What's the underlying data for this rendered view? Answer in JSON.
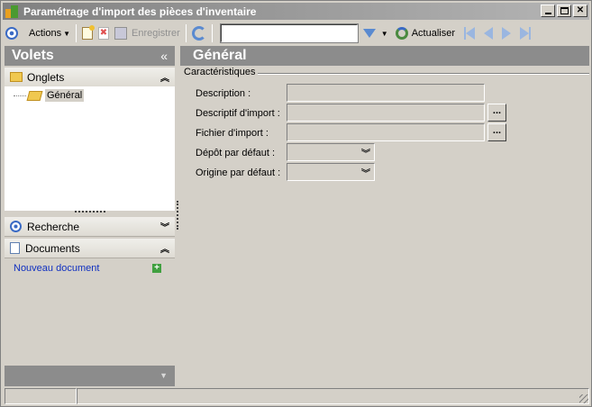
{
  "window": {
    "title": "Paramétrage d'import des pièces d'inventaire"
  },
  "toolbar": {
    "actions_label": "Actions",
    "save_label": "Enregistrer",
    "search_value": "",
    "refresh_label": "Actualiser"
  },
  "left_panel": {
    "title": "Volets",
    "collapse_glyph": "«",
    "onglets": {
      "label": "Onglets",
      "chevron": "︽",
      "items": [
        {
          "label": "Général"
        }
      ]
    },
    "recherche": {
      "label": "Recherche",
      "chevron": "︾"
    },
    "documents": {
      "label": "Documents",
      "chevron": "︽",
      "new_document_label": "Nouveau document"
    },
    "footer_glyph": "▼"
  },
  "main": {
    "title": "Général",
    "group_title": "Caractéristiques",
    "fields": {
      "description": {
        "label": "Description :",
        "value": ""
      },
      "descriptif_import": {
        "label": "Descriptif d'import :",
        "value": "",
        "button": "..."
      },
      "fichier_import": {
        "label": "Fichier d'import :",
        "value": "",
        "button": "..."
      },
      "depot_defaut": {
        "label": "Dépôt par défaut :",
        "value": ""
      },
      "origine_defaut": {
        "label": "Origine par défaut :",
        "value": ""
      }
    }
  },
  "colors": {
    "panel_header": "#8c8c8c",
    "window_bg": "#d4d0c8",
    "link": "#1030c0"
  }
}
